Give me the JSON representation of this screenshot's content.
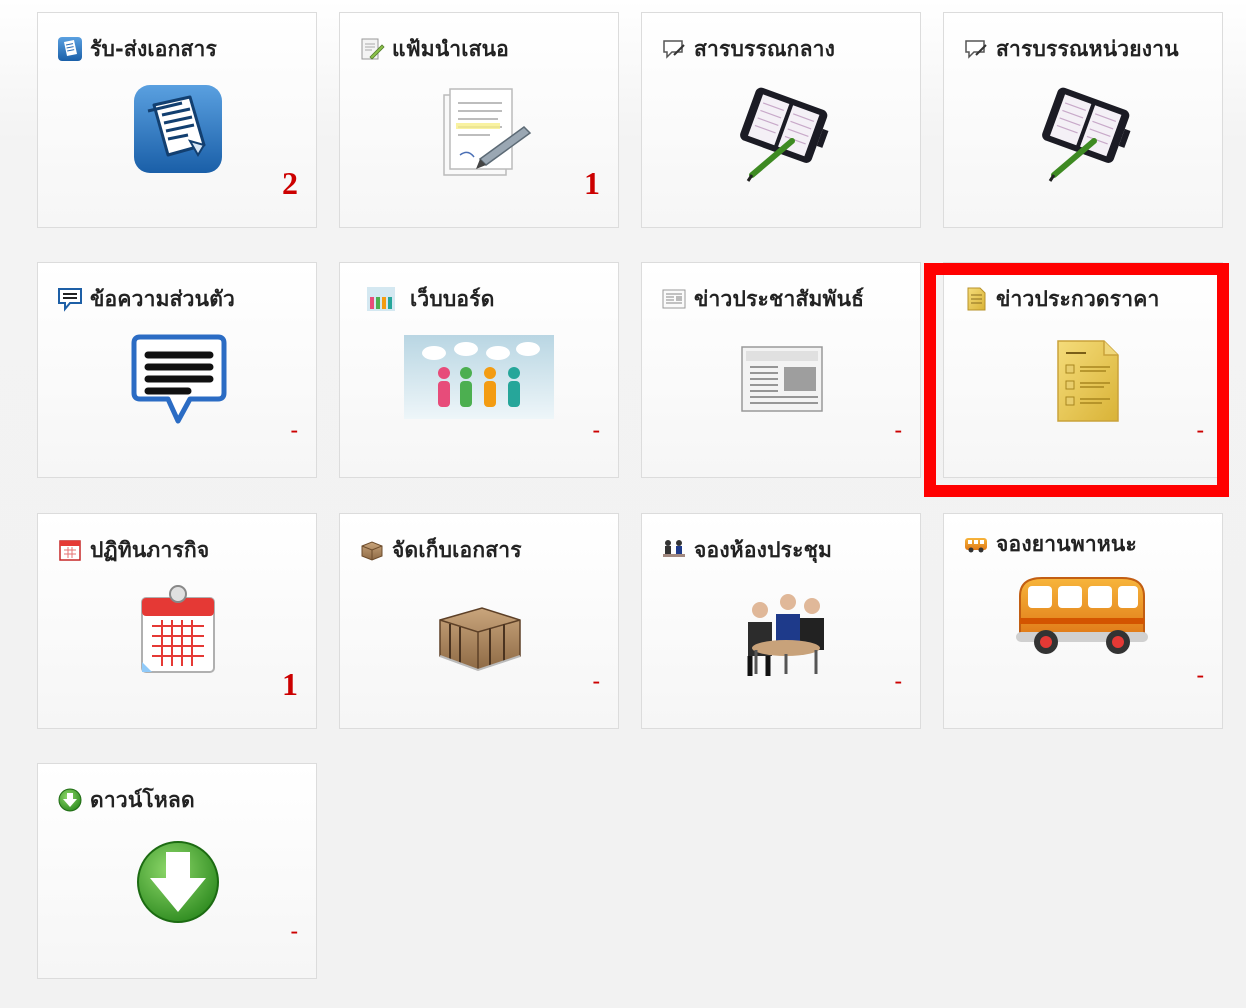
{
  "tiles": [
    {
      "title": "รับ-ส่งเอกสาร",
      "count": "2",
      "head_icon": "document-stack-icon",
      "image": "document-app-icon"
    },
    {
      "title": "แฟ้มนำเสนอ",
      "count": "1",
      "head_icon": "pencil-note-icon",
      "image": "signing-document-icon"
    },
    {
      "title": "สารบรรณกลาง",
      "count": "",
      "head_icon": "speech-bubble-icon",
      "image": "planner-pen-icon"
    },
    {
      "title": "สารบรรณหน่วยงาน",
      "count": "",
      "head_icon": "speech-bubble-icon",
      "image": "planner-pen-icon"
    },
    {
      "title": "ข้อความส่วนตัว",
      "count": "-",
      "head_icon": "message-icon",
      "image": "chat-bubble-icon"
    },
    {
      "title": "เว็บบอร์ด",
      "count": "-",
      "head_icon": "people-icon",
      "image": "people-discussion-icon"
    },
    {
      "title": "ข่าวประชาสัมพันธ์",
      "count": "-",
      "head_icon": "news-icon",
      "image": "newspaper-icon"
    },
    {
      "title": "ข่าวประกวดราคา",
      "count": "-",
      "head_icon": "yellow-document-icon",
      "image": "yellow-document-icon"
    },
    {
      "title": "ปฏิทินภารกิจ",
      "count": "1",
      "head_icon": "calendar-icon",
      "image": "calendar-icon"
    },
    {
      "title": "จัดเก็บเอกสาร",
      "count": "-",
      "head_icon": "box-icon",
      "image": "archive-box-icon"
    },
    {
      "title": "จองห้องประชุม",
      "count": "-",
      "head_icon": "meeting-people-icon",
      "image": "meeting-room-icon"
    },
    {
      "title": "จองยานพาหนะ",
      "count": "-",
      "head_icon": "bus-icon",
      "image": "bus-icon"
    },
    {
      "title": "ดาวน์โหลด",
      "count": "-",
      "head_icon": "download-icon",
      "image": "download-icon"
    }
  ],
  "colors": {
    "count": "#cc0000",
    "highlight": "#ff0000",
    "border": "#dcdcdc"
  }
}
